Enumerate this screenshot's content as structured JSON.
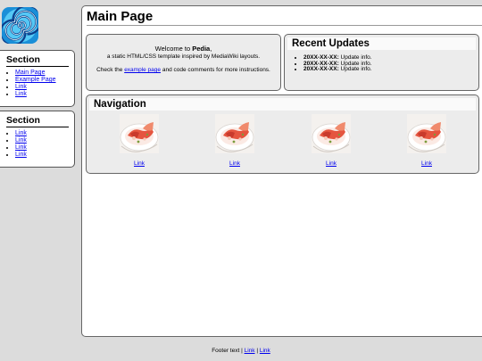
{
  "sidebar": {
    "logo_icon": "spiral-logo-icon",
    "sections": [
      {
        "title": "Section",
        "items": [
          "Main Page",
          "Example Page",
          "Link",
          "Link"
        ]
      },
      {
        "title": "Section",
        "items": [
          "Link",
          "Link",
          "Link",
          "Link"
        ]
      }
    ]
  },
  "main": {
    "title": "Main Page",
    "welcome": {
      "prefix": "Welcome to ",
      "site_name": "Pedia",
      "suffix": ",",
      "tagline": "a static HTML/CSS template inspired by MediaWiki layouts.",
      "check_prefix": "Check the ",
      "example_link": "example page",
      "check_suffix": " and code comments for more instructions."
    },
    "updates": {
      "title": "Recent Updates",
      "items": [
        {
          "date": "20XX-XX-XX:",
          "text": " Update info."
        },
        {
          "date": "20XX-XX-XX:",
          "text": " Update info."
        },
        {
          "date": "20XX-XX-XX:",
          "text": " Update info."
        }
      ]
    },
    "navigation": {
      "title": "Navigation",
      "items": [
        {
          "label": "Link",
          "image": "food-bowl-thumbnail"
        },
        {
          "label": "Link",
          "image": "food-bowl-thumbnail"
        },
        {
          "label": "Link",
          "image": "food-bowl-thumbnail"
        },
        {
          "label": "Link",
          "image": "food-bowl-thumbnail"
        }
      ]
    }
  },
  "footer": {
    "text": "Footer text",
    "separator": " | ",
    "links": [
      "Link",
      "Link"
    ]
  },
  "colors": {
    "background": "#dcdcdc",
    "panel": "#ececec",
    "link": "#0000ee",
    "logo_primary": "#1a8fd8"
  }
}
